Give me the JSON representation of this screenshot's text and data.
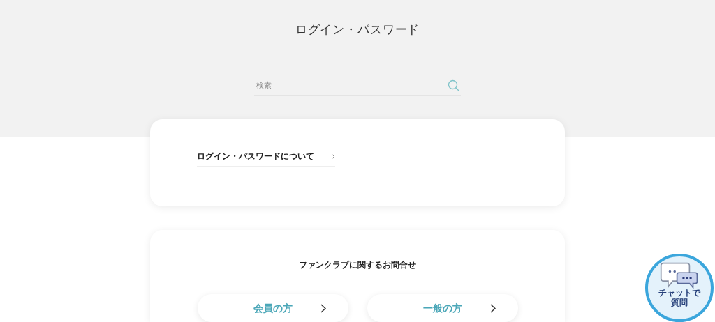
{
  "page_title": "ログイン・パスワード",
  "search": {
    "placeholder": "検索"
  },
  "link_card": {
    "link": "ログイン・パスワードについて"
  },
  "contact_card": {
    "heading": "ファンクラブに関するお問合せ",
    "buttons": [
      {
        "label": "会員の方"
      },
      {
        "label": "一般の方"
      }
    ]
  },
  "chat_button": {
    "label_lines": [
      "チャットで",
      "質問"
    ]
  }
}
